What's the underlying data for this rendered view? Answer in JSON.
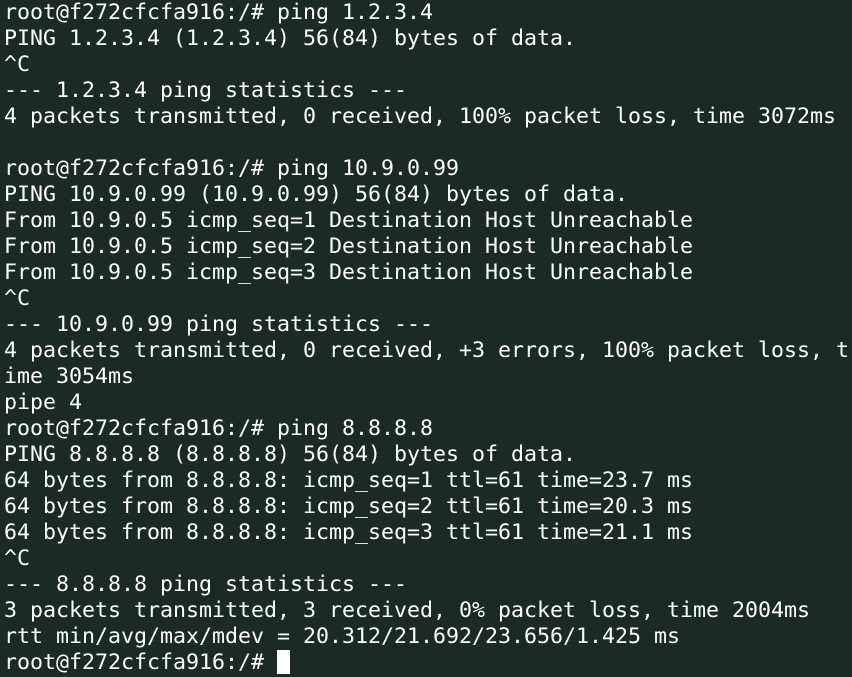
{
  "terminal": {
    "background": "#1c2a26",
    "foreground": "#ffffff",
    "lines": [
      "root@f272cfcfa916:/# ping 1.2.3.4",
      "PING 1.2.3.4 (1.2.3.4) 56(84) bytes of data.",
      "^C",
      "--- 1.2.3.4 ping statistics ---",
      "4 packets transmitted, 0 received, 100% packet loss, time 3072ms",
      "",
      "root@f272cfcfa916:/# ping 10.9.0.99",
      "PING 10.9.0.99 (10.9.0.99) 56(84) bytes of data.",
      "From 10.9.0.5 icmp_seq=1 Destination Host Unreachable",
      "From 10.9.0.5 icmp_seq=2 Destination Host Unreachable",
      "From 10.9.0.5 icmp_seq=3 Destination Host Unreachable",
      "^C",
      "--- 10.9.0.99 ping statistics ---",
      "4 packets transmitted, 0 received, +3 errors, 100% packet loss, t",
      "ime 3054ms",
      "pipe 4",
      "root@f272cfcfa916:/# ping 8.8.8.8",
      "PING 8.8.8.8 (8.8.8.8) 56(84) bytes of data.",
      "64 bytes from 8.8.8.8: icmp_seq=1 ttl=61 time=23.7 ms",
      "64 bytes from 8.8.8.8: icmp_seq=2 ttl=61 time=20.3 ms",
      "64 bytes from 8.8.8.8: icmp_seq=3 ttl=61 time=21.1 ms",
      "^C",
      "--- 8.8.8.8 ping statistics ---",
      "3 packets transmitted, 3 received, 0% packet loss, time 2004ms",
      "rtt min/avg/max/mdev = 20.312/21.692/23.656/1.425 ms"
    ],
    "prompt": "root@f272cfcfa916:/# "
  }
}
